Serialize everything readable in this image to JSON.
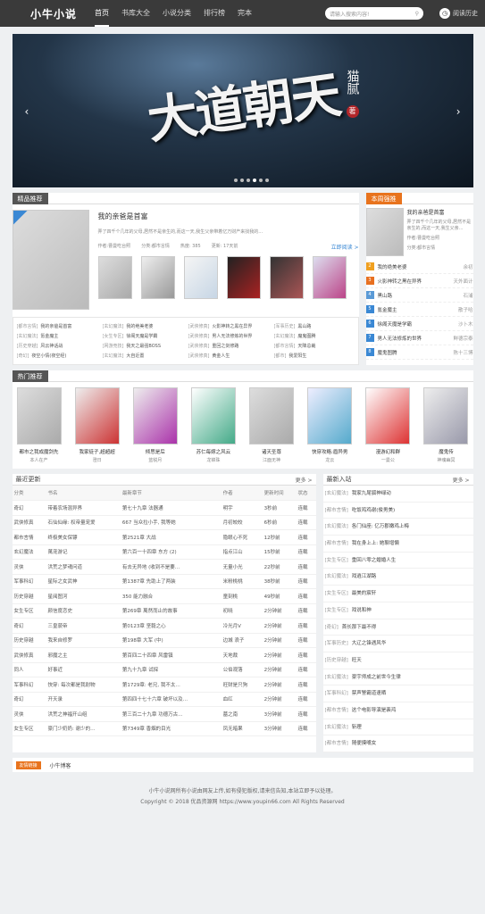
{
  "header": {
    "logo": "小牛小说",
    "nav": [
      "首页",
      "书库大全",
      "小说分类",
      "排行榜",
      "完本"
    ],
    "search_placeholder": "请输入搜索内容!",
    "history": "阅读历史"
  },
  "banner": {
    "title": "大道朝天",
    "author": "猫腻",
    "seal": "著",
    "current_dot": 4,
    "dots": 6
  },
  "recommend": {
    "title": "精品推荐",
    "feature": {
      "name": "我的亲爸是首富",
      "desc": "弄了四千个几年的父母,居然不是亲生的,而这一天,我生父亲带着亿万财产来找我的…",
      "author": "作者:曹曼吃台照",
      "category": "分类:都市言情",
      "clicks": "热度: 385",
      "updated": "更新: 17天前",
      "read": "立即阅读 >"
    },
    "list": [
      [
        "[都市言情]",
        "我的亲爸是首富"
      ],
      [
        "[玄幻魔法]",
        "我的绝美老婆"
      ],
      [
        "[武侠修真]",
        "火影神转之黑在异界"
      ],
      [
        "[军事历史]",
        "黑山路"
      ],
      [
        "[玄幻魔法]",
        "氪金魔主"
      ],
      [
        "[女生专区]",
        "徐阁天魔是学霸"
      ],
      [
        "[武侠修真]",
        "男人无法修炼的世界"
      ],
      [
        "[玄幻魔法]",
        "魔鬼图腾"
      ],
      [
        "[历史穿越]",
        "风云神话战"
      ],
      [
        "[网游竞技]",
        "我天之最强BOSS"
      ],
      [
        "[武侠修真]",
        "重回之剑修路"
      ],
      [
        "[都市言情]",
        "天降总裁"
      ],
      [
        "[奇幻]",
        "夜空小情(夜空经)"
      ],
      [
        "[玄幻魔法]",
        "大自近置"
      ],
      [
        "[武侠修真]",
        "黄金人生"
      ],
      [
        "[都市]",
        "我爱阳生"
      ]
    ]
  },
  "week": {
    "title": "本周强推",
    "top": {
      "name": "我的亲爸是首富",
      "desc": "弄了四千个几年的父母,居然不是亲生的,而这一天,我生父亲…",
      "author": "作者:曹曼吃台照",
      "cat": "分类:都市言情"
    },
    "items": [
      [
        "2",
        "我的绝美老婆",
        "余初"
      ],
      [
        "3",
        "火影神转之黑在异界",
        "天外面计"
      ],
      [
        "4",
        "黑山路",
        "石浦"
      ],
      [
        "5",
        "氪金魔主",
        "散子哈"
      ],
      [
        "6",
        "徐阁天魔是学霸",
        "沙卜木"
      ],
      [
        "7",
        "男人无法修炼的世界",
        "鲜德宗泰"
      ],
      [
        "8",
        "魔鬼图腾",
        "陈十三博"
      ]
    ]
  },
  "hot": {
    "title": "热门推荐",
    "items": [
      [
        "都市之我成魔剑先",
        "本人在产"
      ],
      [
        "我家徒子,超超超",
        "澄日"
      ],
      [
        "倾思是后",
        "蓝锐月"
      ],
      [
        "苏仁每嫁之风云",
        "龙锦珠"
      ],
      [
        "诸天圣尊",
        "江面无神"
      ],
      [
        "快穿攻略:眉异男",
        "龙云"
      ],
      [
        "漫游幻和群",
        "一曼公"
      ],
      [
        "魔鬼传",
        "神魂幽冥"
      ]
    ]
  },
  "updates": {
    "title": "最近更新",
    "more": "更多 >",
    "headers": [
      "分类",
      "书名",
      "最新章节",
      "作者",
      "更新时间",
      "状态"
    ],
    "rows": [
      [
        "奇幻",
        "带着农场混异界",
        "第七十九章 法器通",
        "明宇",
        "3秒前",
        "连载"
      ],
      [
        "武侠修真",
        "石仙仙缘: 权帝量宠爱",
        "667 当众拉小手, 我等她",
        "月初皎皎",
        "6秒前",
        "连载"
      ],
      [
        "都市言情",
        "终极美女保镖",
        "第2521章 大战",
        "隐眼心不死",
        "12秒前",
        "连载"
      ],
      [
        "玄幻魔法",
        "萬宠游记",
        "第六百一十四章 东方 (2)",
        "指点江山",
        "15秒前",
        "连载"
      ],
      [
        "灵侠",
        "洪荒之梦魂问道",
        "有去无异地 (收到不是要…",
        "无量小光",
        "22秒前",
        "连载"
      ],
      [
        "军事科幻",
        "星际之女武神",
        "第1387章 先助上了两装",
        "米粉桃桃",
        "38秒前",
        "连载"
      ],
      [
        "历史穿越",
        "星阅图河",
        "350 能力融合",
        "童刻桃",
        "49秒前",
        "连载"
      ],
      [
        "女生专区",
        "颜信度恋史",
        "第269章 萬然而止的故事",
        "初晓",
        "2分钟前",
        "连载"
      ],
      [
        "奇幻",
        "三皇藐帝",
        "第0123章 坚毅之心",
        "冷光月V",
        "2分钟前",
        "连载"
      ],
      [
        "历史穿越",
        "我来自修罗",
        "第198章 大军 (中)",
        "边城 浪子",
        "2分钟前",
        "连载"
      ],
      [
        "武侠修真",
        "邪魔之主",
        "第百四二十四章 风雷镇",
        "天地裁",
        "2分钟前",
        "连载"
      ],
      [
        "同人",
        "好事近",
        "第九十九章 试探",
        "公伯观落",
        "2分钟前",
        "连载"
      ],
      [
        "军事科幻",
        "快穿: 每次都是我耐物",
        "第1729章: 老兄, 我不太…",
        "旺财是只狗",
        "2分钟前",
        "连载"
      ],
      [
        "奇幻",
        "开天录",
        "第四四十七十六章 破坏以及…",
        "血红",
        "2分钟前",
        "连载"
      ],
      [
        "灵侠",
        "洪荒之神福开山组",
        "第三百二十九章 功德万古…",
        "墓之南",
        "3分钟前",
        "连载"
      ],
      [
        "女生专区",
        "豪门少奶奶: 谢少的…",
        "第7349章 香烟的目光",
        "凤无暗果",
        "3分钟前",
        "连载"
      ]
    ]
  },
  "newin": {
    "title": "最新入站",
    "more": "更多 >",
    "items": [
      [
        "[玄幻魔法]",
        "我家九尾狐神绿动"
      ],
      [
        "[都市言情]",
        "吃饭鸡鸡谢(俊男美)"
      ],
      [
        "[玄幻魔法]",
        "各门仙座: 亿万郡嫩鸡上梅"
      ],
      [
        "[都市言情]",
        "我在身上上: 她聊增懒"
      ],
      [
        "[女生专区]",
        "重回八零之婚婚人生"
      ],
      [
        "[玄幻魔法]",
        "戏逍江湖路"
      ],
      [
        "[女生专区]",
        "最美的宸轩"
      ],
      [
        "[女生专区]",
        "戏说和神"
      ],
      [
        "[奇幻]",
        "首长那下最不得"
      ],
      [
        "[军事历史]",
        "大辽之锋遇风华"
      ],
      [
        "[历史穿越]",
        "旺天"
      ],
      [
        "[玄幻魔法]",
        "豪宇师成之前世今生律"
      ],
      [
        "[军事科幻]",
        "禁声警霸道速晒"
      ],
      [
        "[都市言情]",
        "这个电影导演是裴鸿"
      ],
      [
        "[玄幻魔法]",
        "斩理"
      ],
      [
        "[都市言情]",
        "随便摸嘴女"
      ]
    ]
  },
  "links": {
    "label": "友情链接",
    "items": [
      "小牛博客"
    ]
  },
  "footer": {
    "line1": "小牛小说网所有小说由网友上传,如有侵犯版权,请来信告知,本站立即予以处理。",
    "line2": "Copyright © 2018 优品资源网 https://www.youpin66.com All Rights Reserved"
  }
}
